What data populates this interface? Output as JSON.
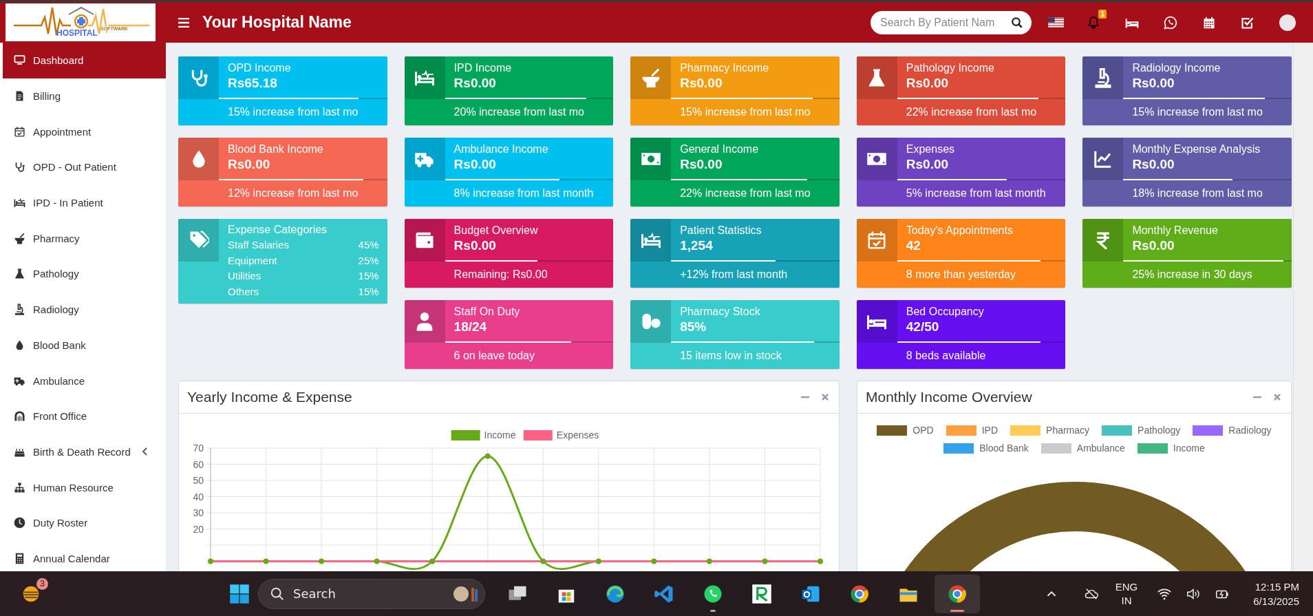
{
  "header": {
    "logo": {
      "text": "HOSPITAL",
      "subtext": "SOFTWARE"
    },
    "title": "Your Hospital Name",
    "search": {
      "placeholder": "Search By Patient Nam"
    },
    "notification_count": "1"
  },
  "sidebar": {
    "items": [
      {
        "label": "Dashboard",
        "selected": true,
        "has_submenu": false
      },
      {
        "label": "Billing",
        "selected": false,
        "has_submenu": false
      },
      {
        "label": "Appointment",
        "selected": false,
        "has_submenu": false
      },
      {
        "label": "OPD - Out Patient",
        "selected": false,
        "has_submenu": false
      },
      {
        "label": "IPD - In Patient",
        "selected": false,
        "has_submenu": false
      },
      {
        "label": "Pharmacy",
        "selected": false,
        "has_submenu": false
      },
      {
        "label": "Pathology",
        "selected": false,
        "has_submenu": false
      },
      {
        "label": "Radiology",
        "selected": false,
        "has_submenu": false
      },
      {
        "label": "Blood Bank",
        "selected": false,
        "has_submenu": false
      },
      {
        "label": "Ambulance",
        "selected": false,
        "has_submenu": false
      },
      {
        "label": "Front Office",
        "selected": false,
        "has_submenu": false
      },
      {
        "label": "Birth & Death Record",
        "selected": false,
        "has_submenu": true
      },
      {
        "label": "Human Resource",
        "selected": false,
        "has_submenu": false
      },
      {
        "label": "Duty Roster",
        "selected": false,
        "has_submenu": false
      },
      {
        "label": "Annual Calendar",
        "selected": false,
        "has_submenu": false
      }
    ]
  },
  "cards": [
    {
      "kind": "stat",
      "title": "OPD Income",
      "value": "Rs65.18",
      "level": 0.83,
      "footer": "15% increase from last mo",
      "color": "#00c0ef"
    },
    {
      "kind": "stat",
      "title": "IPD Income",
      "value": "Rs0.00",
      "level": 0.84,
      "footer": "20% increase from last mo",
      "color": "#00a65a"
    },
    {
      "kind": "stat",
      "title": "Pharmacy Income",
      "value": "Rs0.00",
      "level": 0.84,
      "footer": "15% increase from last mo",
      "color": "#f39c12"
    },
    {
      "kind": "stat",
      "title": "Pathology Income",
      "value": "Rs0.00",
      "level": 0.84,
      "footer": "22% increase from last mo",
      "color": "#dd4b39"
    },
    {
      "kind": "stat",
      "title": "Radiology Income",
      "value": "Rs0.00",
      "level": 0.84,
      "footer": "15% increase from last mo",
      "color": "#605ca8"
    },
    {
      "kind": "stat",
      "title": "Blood Bank Income",
      "value": "Rs0.00",
      "level": 0.86,
      "footer": "12% increase from last mo",
      "color": "#f56954"
    },
    {
      "kind": "stat",
      "title": "Ambulance Income",
      "value": "Rs0.00",
      "level": 0.68,
      "footer": "8% increase from last month",
      "color": "#00c0ef"
    },
    {
      "kind": "stat",
      "title": "General Income",
      "value": "Rs0.00",
      "level": 0.81,
      "footer": "22% increase from last mo",
      "color": "#00a65a"
    },
    {
      "kind": "stat",
      "title": "Expenses",
      "value": "Rs0.00",
      "level": 0.65,
      "footer": "5% increase from last month",
      "color": "#6f42c1"
    },
    {
      "kind": "stat",
      "title": "Monthly Expense Analysis",
      "value": "Rs0.00",
      "level": 0.65,
      "footer": "18% increase from last mo",
      "color": "#605ca8"
    },
    {
      "kind": "breakdown",
      "title": "Expense Categories",
      "color": "#39cccc",
      "rows": [
        {
          "name": "Staff Salaries",
          "value": "45%"
        },
        {
          "name": "Equipment",
          "value": "25%"
        },
        {
          "name": "Utilities",
          "value": "15%"
        },
        {
          "name": "Others",
          "value": "15%"
        }
      ]
    },
    {
      "kind": "stat",
      "title": "Budget Overview",
      "value": "Rs0.00",
      "level": 0.55,
      "footer": "Remaining: Rs0.00",
      "color": "#d81b60"
    },
    {
      "kind": "stat",
      "title": "Patient Statistics",
      "value": "1,254",
      "level": 0.62,
      "footer": "+12% from last month",
      "color": "#17a2b8"
    },
    {
      "kind": "stat",
      "title": "Today's Appointments",
      "value": "42",
      "level": 0.85,
      "footer": "8 more than yesterday",
      "color": "#ff851b"
    },
    {
      "kind": "stat",
      "title": "Monthly Revenue",
      "value": "Rs0.00",
      "level": 0.95,
      "footer": "25% increase in 30 days",
      "color": "#5fad18"
    },
    {
      "kind": "stat",
      "title": "Staff On Duty",
      "value": "18/24",
      "level": 0.75,
      "footer": "6 on leave today",
      "color": "#e83e8c"
    },
    {
      "kind": "stat",
      "title": "Pharmacy Stock",
      "value": "85%",
      "level": 0.85,
      "footer": "15 items low in stock",
      "color": "#39cccc"
    },
    {
      "kind": "stat",
      "title": "Bed Occupancy",
      "value": "42/50",
      "level": 0.85,
      "footer": "8 beds available",
      "color": "#6610f2"
    }
  ],
  "panels": [
    {
      "title": "Yearly Income & Expense",
      "chart_data": {
        "type": "line",
        "grid": true,
        "legend": "top",
        "ylim": [
          0,
          70
        ],
        "yticks": [
          20,
          30,
          40,
          50,
          60,
          70
        ],
        "series": [
          {
            "name": "Income",
            "color": "#66aa18",
            "marker": true,
            "values": [
              0,
              0,
              0,
              0,
              0,
              65,
              0,
              0,
              0,
              0,
              0,
              0
            ]
          },
          {
            "name": "Expenses",
            "color": "#ff6384",
            "values": [
              0,
              0,
              0,
              0,
              0,
              0,
              0,
              0,
              0,
              0,
              0,
              0
            ]
          }
        ]
      }
    },
    {
      "title": "Monthly Income Overview",
      "legend": [
        {
          "label": "OPD",
          "color": "#715b22"
        },
        {
          "label": "IPD",
          "color": "#ff9f40"
        },
        {
          "label": "Pharmacy",
          "color": "#ffcd56"
        },
        {
          "label": "Pathology",
          "color": "#4bc0c0"
        },
        {
          "label": "Radiology",
          "color": "#9966ff"
        },
        {
          "label": "Blood Bank",
          "color": "#36a2eb"
        },
        {
          "label": "Ambulance",
          "color": "#c9cbcf"
        },
        {
          "label": "Income",
          "color": "#41b883"
        }
      ]
    }
  ],
  "taskbar": {
    "weather_badge": "3",
    "search": {
      "placeholder": "Search"
    },
    "apps": [
      {
        "running": false,
        "active": false
      },
      {
        "running": false,
        "active": false
      },
      {
        "running": false,
        "active": false
      },
      {
        "running": false,
        "active": false
      },
      {
        "running": true,
        "active": false
      },
      {
        "running": false,
        "active": false
      },
      {
        "running": false,
        "active": false
      },
      {
        "running": false,
        "active": false
      },
      {
        "running": false,
        "active": false
      },
      {
        "running": true,
        "active": true
      }
    ],
    "language": "ENG",
    "region": "IN",
    "time": "12:15 PM",
    "date": "6/13/2025"
  }
}
